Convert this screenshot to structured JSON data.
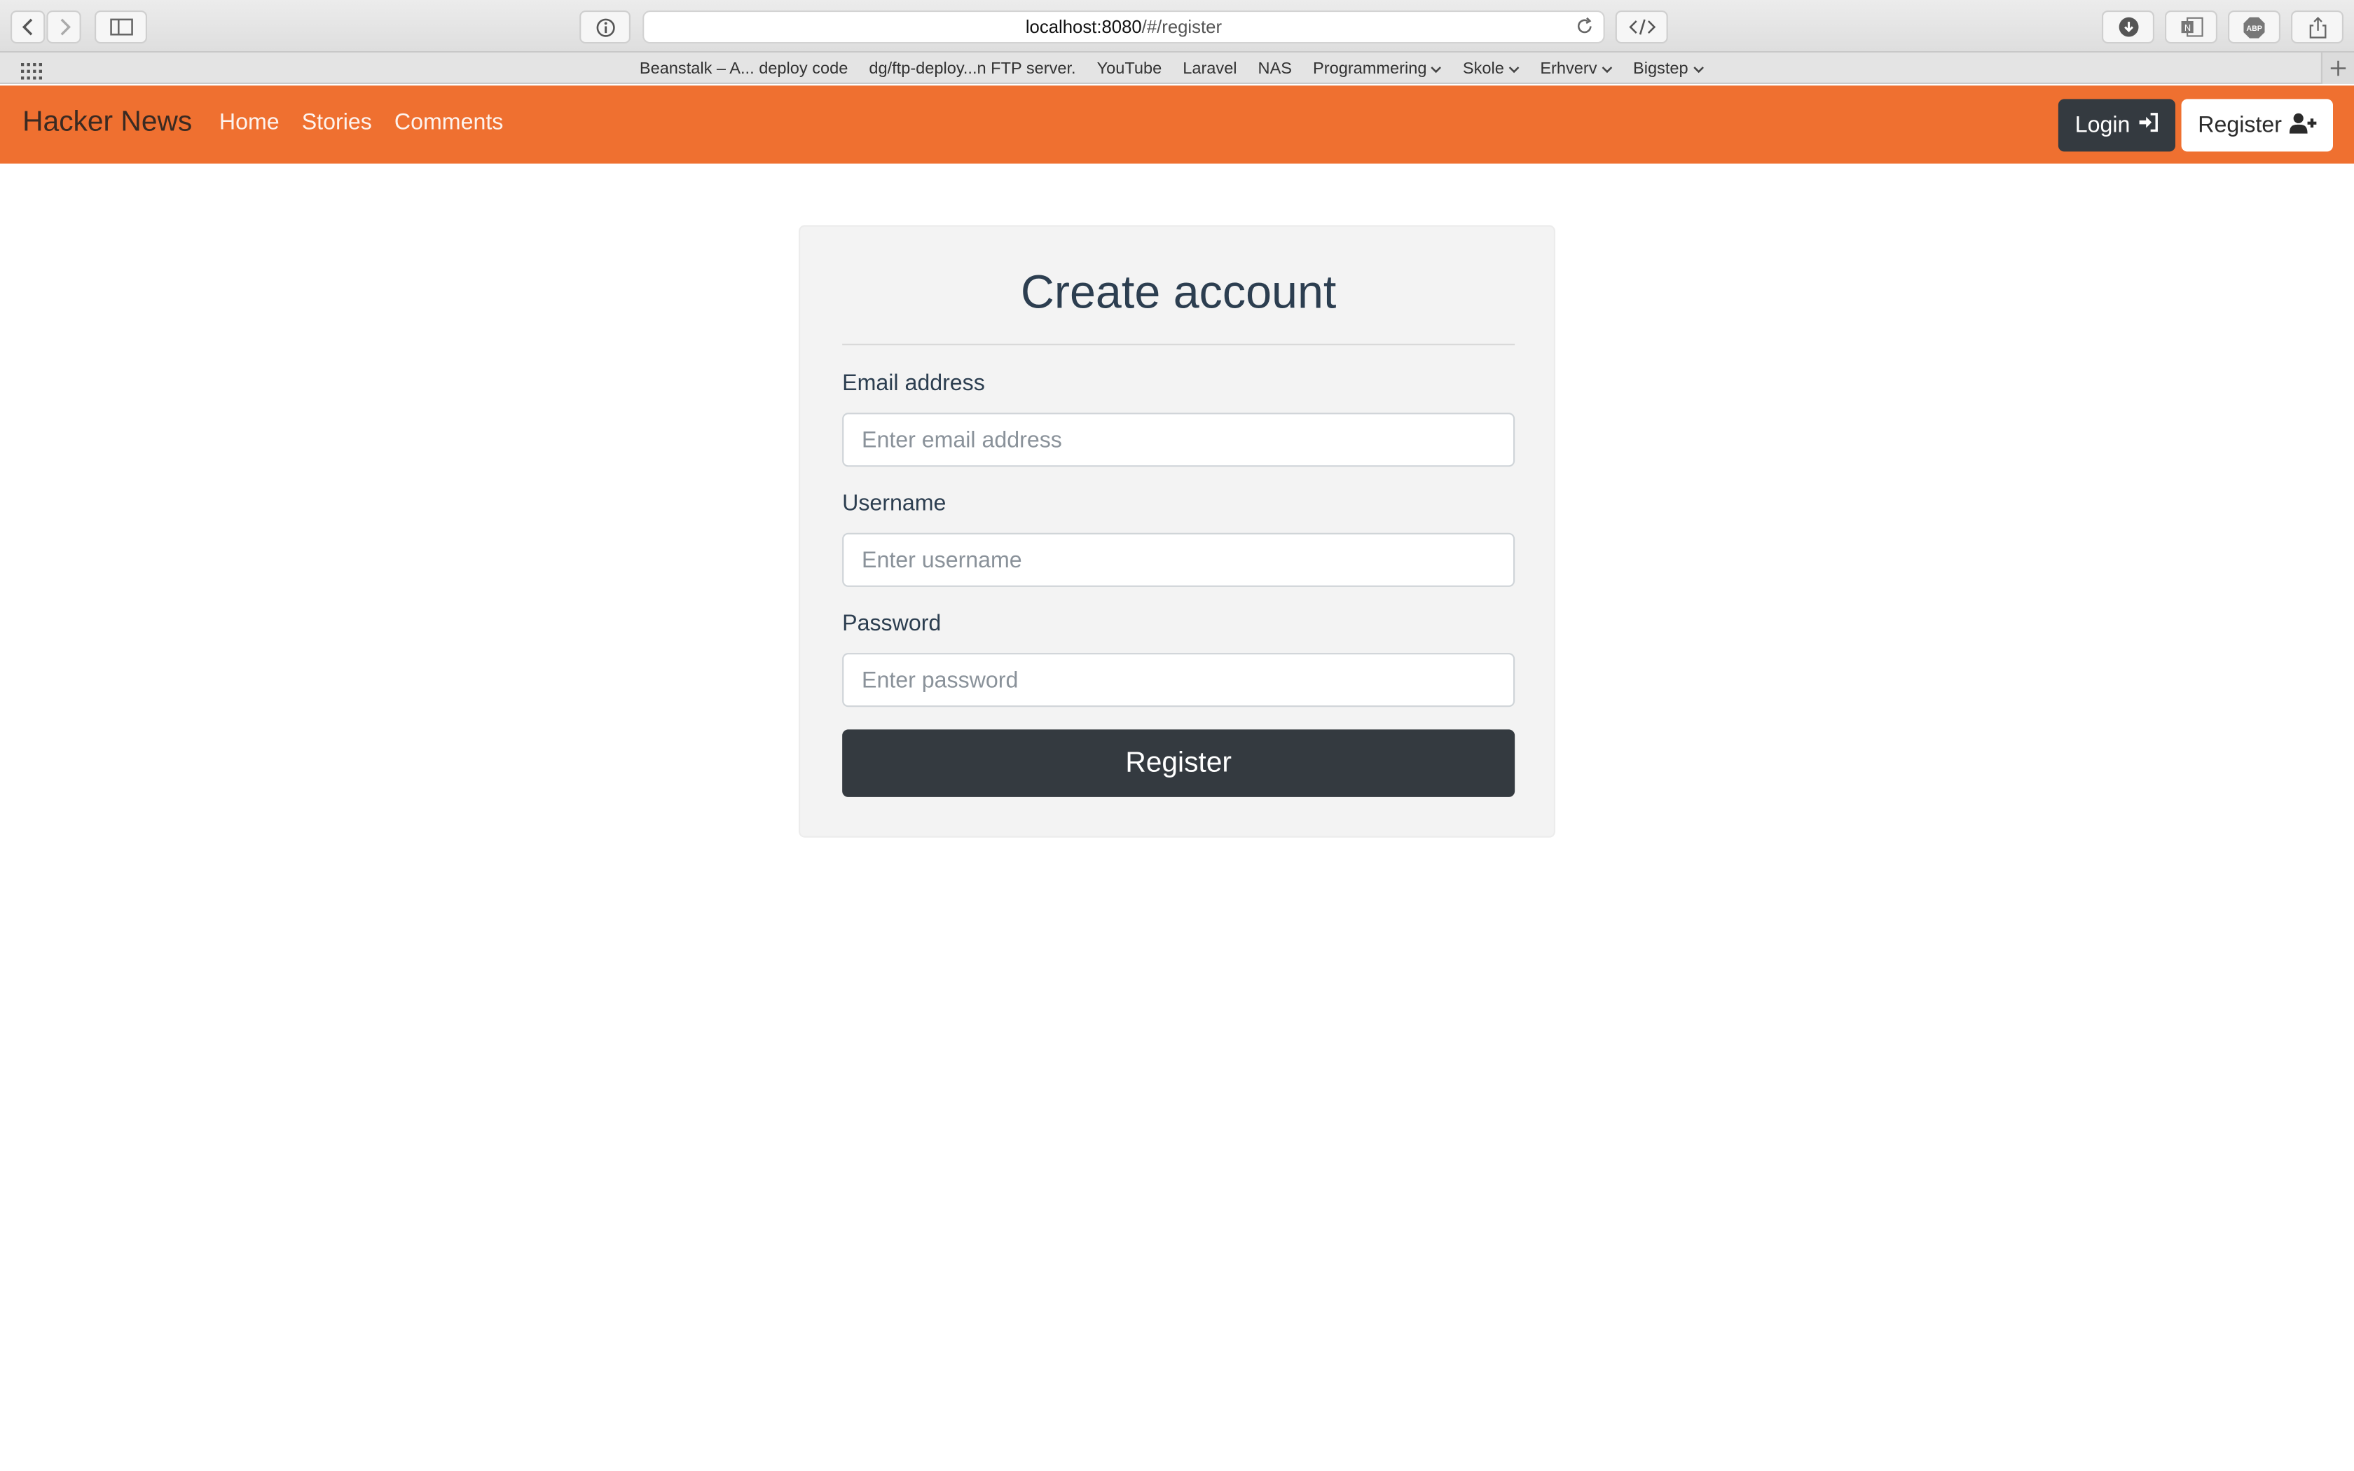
{
  "browser": {
    "url_host": "localhost:8080",
    "url_path": "/#/register",
    "bookmarks": [
      {
        "label": "Beanstalk – A... deploy code",
        "dropdown": false
      },
      {
        "label": "dg/ftp-deploy...n FTP server.",
        "dropdown": false
      },
      {
        "label": "YouTube",
        "dropdown": false
      },
      {
        "label": "Laravel",
        "dropdown": false
      },
      {
        "label": "NAS",
        "dropdown": false
      },
      {
        "label": "Programmering",
        "dropdown": true
      },
      {
        "label": "Skole",
        "dropdown": true
      },
      {
        "label": "Erhverv",
        "dropdown": true
      },
      {
        "label": "Bigstep",
        "dropdown": true
      }
    ],
    "toolbar_icons": [
      "back-icon",
      "forward-icon",
      "sidebar-icon",
      "info-icon",
      "reload-icon",
      "code-icon",
      "download-icon",
      "onenote-icon",
      "adblock-icon",
      "share-icon"
    ]
  },
  "navbar": {
    "brand": "Hacker News",
    "links": [
      "Home",
      "Stories",
      "Comments"
    ],
    "login_label": "Login",
    "register_label": "Register",
    "background": "#ef7030"
  },
  "form": {
    "title": "Create account",
    "email_label": "Email address",
    "email_placeholder": "Enter email address",
    "username_label": "Username",
    "username_placeholder": "Enter username",
    "password_label": "Password",
    "password_placeholder": "Enter password",
    "submit_label": "Register"
  },
  "colors": {
    "accent": "#ef7030",
    "dark_button": "#343a40",
    "heading": "#2c3e50"
  }
}
